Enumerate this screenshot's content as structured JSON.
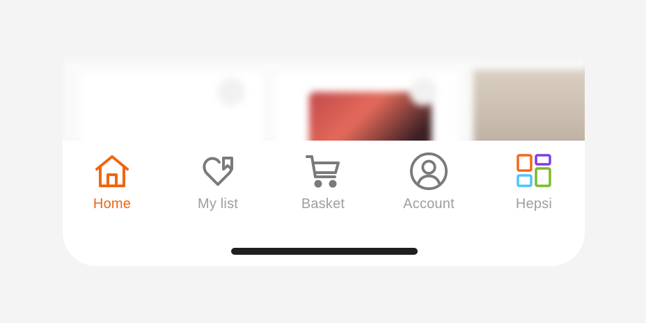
{
  "colors": {
    "accent": "#f06513",
    "inactive": "#9e9e9e",
    "icon_gray": "#7a7a7a",
    "hepsi_orange": "#f26a1b",
    "hepsi_purple": "#7b3fe4",
    "hepsi_blue": "#4fc3f7",
    "hepsi_green": "#7cb82f",
    "home_indicator": "#1f1f1f"
  },
  "tabbar": {
    "tabs": [
      {
        "id": "home",
        "label": "Home",
        "icon": "home-icon",
        "active": true
      },
      {
        "id": "mylist",
        "label": "My list",
        "icon": "heart-bookmark-icon",
        "active": false
      },
      {
        "id": "basket",
        "label": "Basket",
        "icon": "cart-icon",
        "active": false
      },
      {
        "id": "account",
        "label": "Account",
        "icon": "user-circle-icon",
        "active": false
      },
      {
        "id": "hepsi",
        "label": "Hepsi",
        "icon": "hepsi-grid-icon",
        "active": false
      }
    ]
  },
  "products": [
    {
      "icon": "heart-icon"
    },
    {
      "icon": "heart-icon"
    },
    {
      "icon": ""
    }
  ]
}
